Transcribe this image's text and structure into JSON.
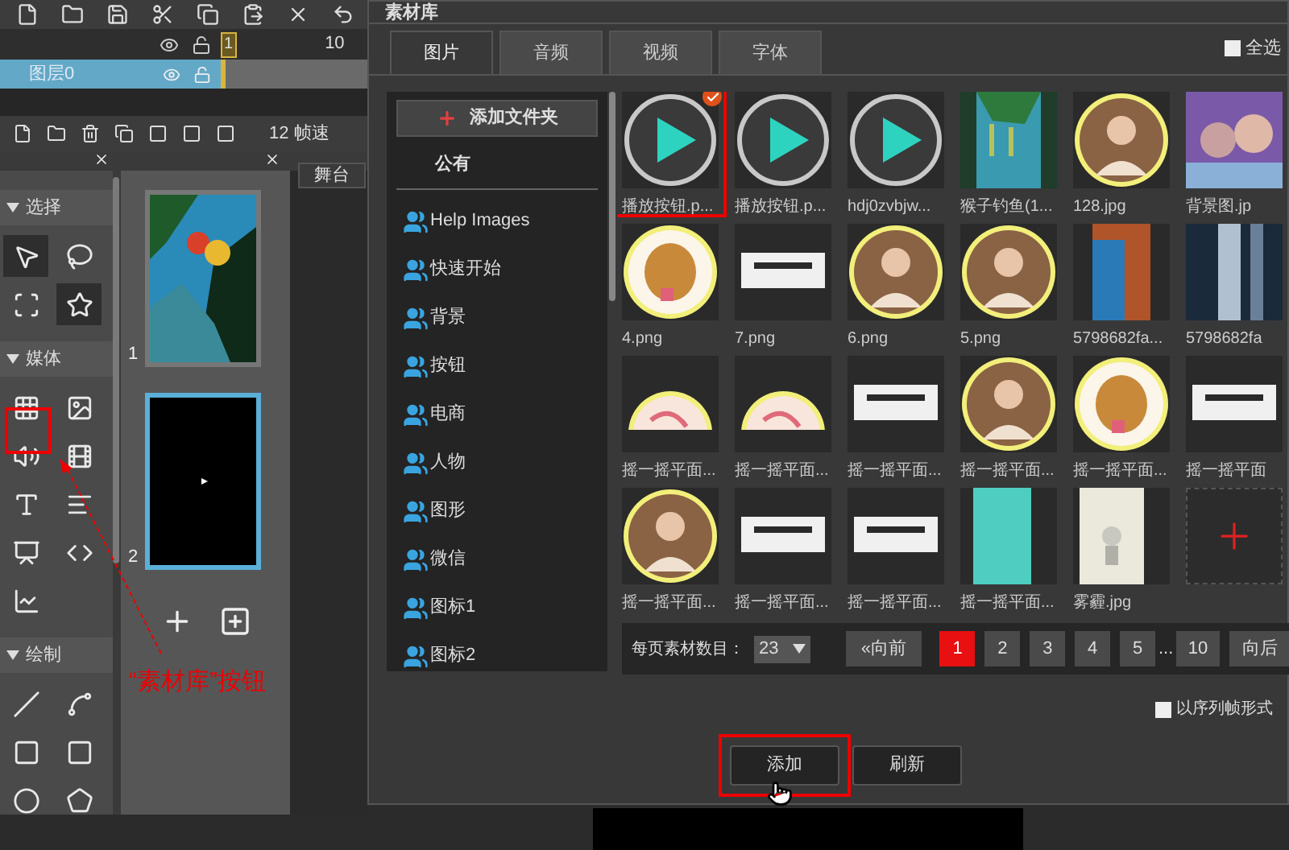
{
  "timeline": {
    "ruler_labels": [
      "1",
      "10"
    ],
    "layers": [
      {
        "name": "图层0",
        "selected": true
      }
    ]
  },
  "frame_rate": "12 帧速",
  "stage_tab": "舞台",
  "tool_sections": [
    {
      "title": "选择",
      "tools": [
        {
          "selected": true
        },
        {
          "selected": false
        },
        {
          "selected": false
        },
        {
          "selected": true
        }
      ]
    },
    {
      "title": "媒体",
      "tools": [
        {
          "selected": false
        },
        {
          "selected": false
        },
        {
          "selected": false
        },
        {
          "selected": false
        },
        {
          "selected": false
        },
        {
          "selected": false
        },
        {
          "selected": false
        },
        {
          "selected": false
        },
        {
          "selected": false
        }
      ]
    },
    {
      "title": "绘制",
      "tools": [
        {
          "selected": false
        },
        {
          "selected": false
        },
        {
          "selected": false
        },
        {
          "selected": false
        },
        {
          "selected": false
        },
        {
          "selected": false
        }
      ]
    }
  ],
  "pages": [
    {
      "number": "1",
      "selected": false
    },
    {
      "number": "2",
      "selected": true
    }
  ],
  "annotation": "“素材库”按钮",
  "dialog": {
    "title": "素材库",
    "tabs": [
      {
        "label": "图片",
        "selected": true
      },
      {
        "label": "音频",
        "selected": false
      },
      {
        "label": "视频",
        "selected": false
      },
      {
        "label": "字体",
        "selected": false
      }
    ],
    "select_all": {
      "label": "全选",
      "checked": false
    },
    "add_folder": "添加文件夹",
    "folder_heading": "公有",
    "folders": [
      "Help Images",
      "快速开始",
      "背景",
      "按钮",
      "电商",
      "人物",
      "图形",
      "微信",
      "图标1",
      "图标2"
    ],
    "assets": [
      {
        "kind": "play",
        "label": "播放按钮.p...",
        "selected": true
      },
      {
        "kind": "play",
        "label": "播放按钮.p...",
        "selected": false
      },
      {
        "kind": "play",
        "label": "hdj0zvbjw...",
        "selected": false
      },
      {
        "kind": "picture",
        "label": "猴子钓鱼(1...",
        "selected": false
      },
      {
        "kind": "picture",
        "label": "128.jpg",
        "selected": false
      },
      {
        "kind": "picture",
        "label": "背景图.jp",
        "selected": false
      },
      {
        "kind": "picture",
        "label": "4.png",
        "selected": false
      },
      {
        "kind": "picture",
        "label": "7.png",
        "selected": false
      },
      {
        "kind": "picture",
        "label": "6.png",
        "selected": false
      },
      {
        "kind": "picture",
        "label": "5.png",
        "selected": false
      },
      {
        "kind": "picture",
        "label": "5798682fa...",
        "selected": false
      },
      {
        "kind": "picture",
        "label": "5798682fa",
        "selected": false
      },
      {
        "kind": "picture",
        "label": "摇一摇平面...",
        "selected": false
      },
      {
        "kind": "picture",
        "label": "摇一摇平面...",
        "selected": false
      },
      {
        "kind": "picture",
        "label": "摇一摇平面...",
        "selected": false
      },
      {
        "kind": "picture",
        "label": "摇一摇平面...",
        "selected": false
      },
      {
        "kind": "picture",
        "label": "摇一摇平面...",
        "selected": false
      },
      {
        "kind": "picture",
        "label": "摇一摇平面",
        "selected": false
      },
      {
        "kind": "picture",
        "label": "摇一摇平面...",
        "selected": false
      },
      {
        "kind": "picture",
        "label": "摇一摇平面...",
        "selected": false
      },
      {
        "kind": "picture",
        "label": "摇一摇平面...",
        "selected": false
      },
      {
        "kind": "picture",
        "label": "摇一摇平面...",
        "selected": false
      },
      {
        "kind": "picture",
        "label": "雾霾.jpg",
        "selected": false
      },
      {
        "kind": "add"
      }
    ],
    "per_page_label": "每页素材数目：",
    "per_page": "23",
    "prev": "«向前",
    "pages": [
      {
        "label": "1",
        "selected": true
      },
      {
        "label": "2",
        "selected": false
      },
      {
        "label": "3",
        "selected": false
      },
      {
        "label": "4",
        "selected": false
      },
      {
        "label": "5",
        "selected": false
      }
    ],
    "ellipsis": "...",
    "last_page": "10",
    "next": "向后",
    "sequence_option": {
      "label": "以序列帧形式",
      "checked": false
    },
    "buttons": [
      "添加",
      "刷新"
    ]
  }
}
